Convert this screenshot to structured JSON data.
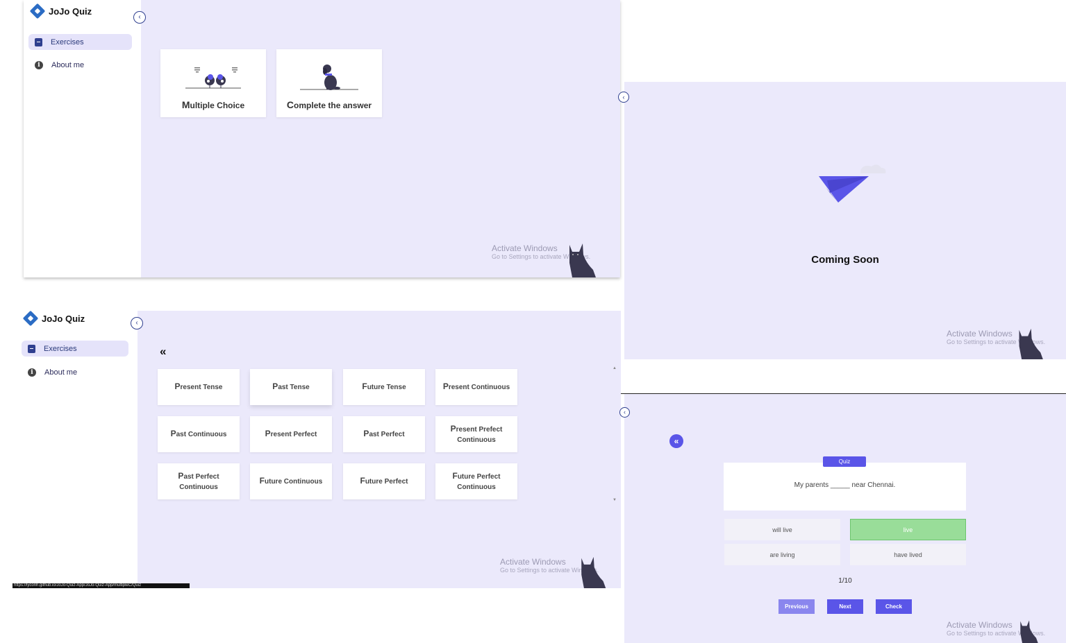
{
  "app": {
    "title": "JoJo Quiz"
  },
  "sidebar": {
    "items": [
      {
        "label": "Exercises",
        "icon": "book-icon",
        "active": true
      },
      {
        "label": "About me",
        "icon": "info-icon",
        "active": false
      }
    ]
  },
  "exercise_types": [
    {
      "label": "Multiple Choice"
    },
    {
      "label": "Complete the answer"
    }
  ],
  "tenses": [
    "Present Tense",
    "Past Tense",
    "Future Tense",
    "Present Continuous",
    "Past Continuous",
    "Present Perfect",
    "Past Perfect",
    "Present Prefect Continuous",
    "Past Perfect Continuous",
    "Future Continuous",
    "Future Perfect",
    "Future Perfect Continuous"
  ],
  "back_icon": "«",
  "coming_soon": {
    "label": "Coming Soon"
  },
  "quiz": {
    "badge": "Quiz",
    "question": "My parents _____ near Chennai.",
    "options": [
      "will live",
      "live",
      "are living",
      "have lived"
    ],
    "selected_option": "live",
    "progress": "1/10",
    "buttons": {
      "previous": "Previous",
      "next": "Next",
      "check": "Check"
    }
  },
  "watermark": {
    "line1": "Activate Windows",
    "line2": "Go to Settings to activate Windows."
  },
  "status_url": "https://lyconh.github.io/JoJo-Quiz-App/JoJo-Quiz-App/multipleC/Quiz",
  "colors": {
    "panel_bg": "#ebe9fb",
    "brand_blue": "#2b6cc4",
    "accent_purple": "#5a55e8",
    "correct_green": "#99dd99",
    "previous_btn": "#8a86ee"
  }
}
